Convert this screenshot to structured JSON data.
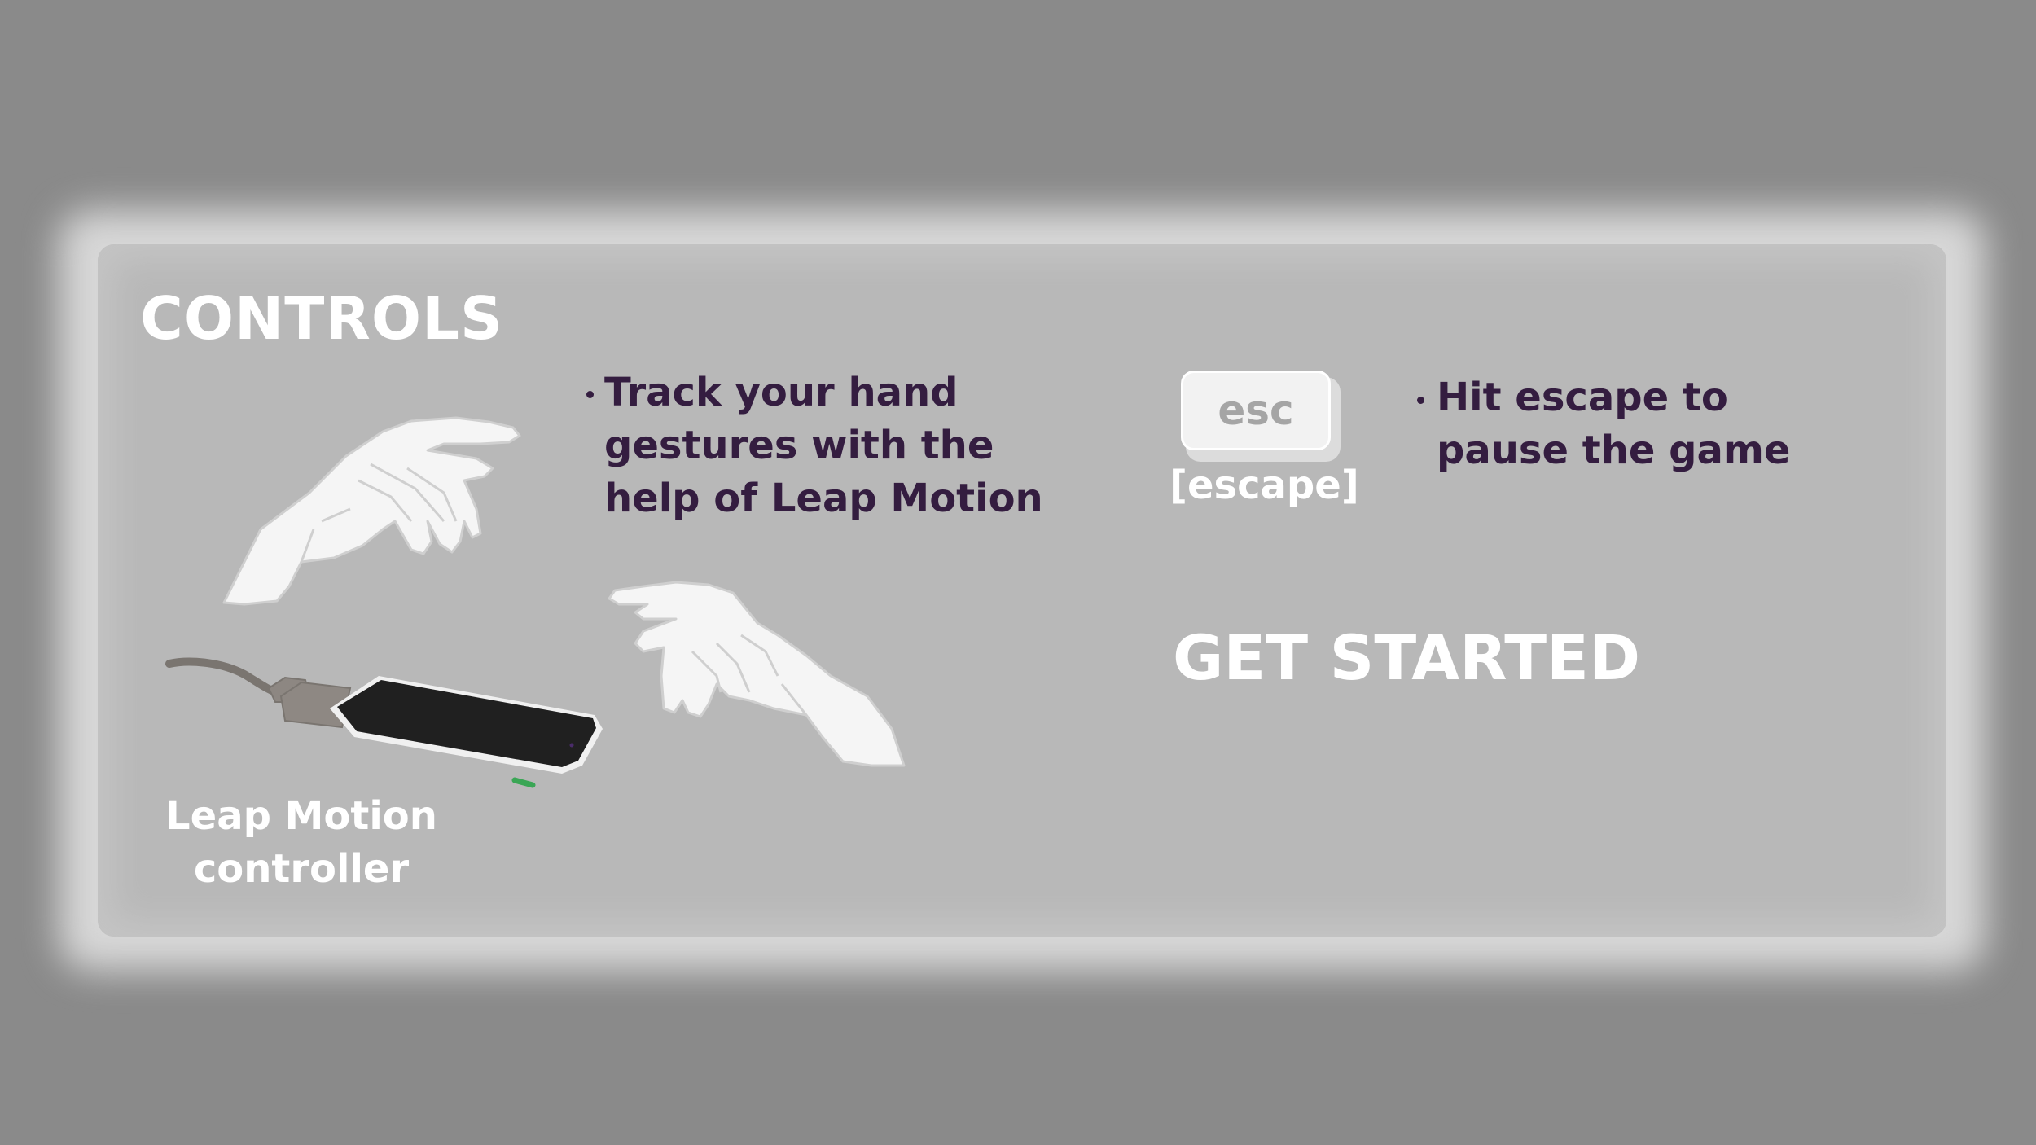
{
  "screen": {
    "title": "CONTROLS",
    "bullet_glyph": "·"
  },
  "leap_motion": {
    "instruction_lines": [
      "Track your hand",
      "gestures with the",
      "help of Leap Motion"
    ],
    "device_caption_lines": [
      "Leap Motion",
      "controller"
    ],
    "icons": [
      "hand-icon",
      "leap-motion-device-icon"
    ]
  },
  "escape": {
    "key_label": "esc",
    "key_caption": "[escape]",
    "instruction_lines": [
      "Hit escape to",
      "pause the game"
    ]
  },
  "actions": {
    "get_started_label": "GET STARTED"
  },
  "colors": {
    "background": "#8a8a8a",
    "panel": "#b8b8b8",
    "panel_glow": "#d7d7d7",
    "heading_text": "#ffffff",
    "instruction_text": "#341d40",
    "device_body": "#1f1f1f",
    "device_led": "#3aa655"
  }
}
